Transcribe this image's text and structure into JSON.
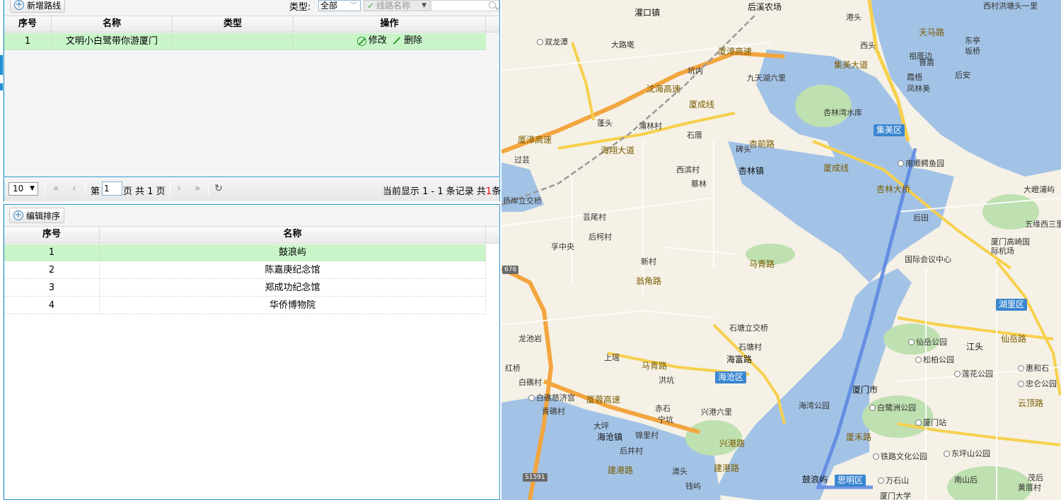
{
  "routes": {
    "add_button": "新增路线",
    "type_label": "类型:",
    "type_value": "全部",
    "search_placeholder": "线路名称",
    "columns": [
      "序号",
      "名称",
      "类型",
      "操作"
    ],
    "rows": [
      {
        "index": "1",
        "name": "文明小白鹭带你游厦门",
        "type": "",
        "edit": "修改",
        "delete": "删除"
      }
    ]
  },
  "pager": {
    "page_size": "10",
    "page_prefix": "第",
    "page_value": "1",
    "page_suffix": "页 共 1 页",
    "display_text": "当前显示  1 - 1 条记录  共",
    "total": "1",
    "total_suffix": "条"
  },
  "sites": {
    "edit_button": "编辑排序",
    "columns": [
      "序号",
      "名称"
    ],
    "rows": [
      {
        "index": "1",
        "name": "鼓浪屿"
      },
      {
        "index": "2",
        "name": "陈嘉庚纪念馆"
      },
      {
        "index": "3",
        "name": "郑成功纪念馆"
      },
      {
        "index": "4",
        "name": "华侨博物院"
      }
    ]
  },
  "map": {
    "labels": [
      "灌口镇",
      "后溪农场",
      "港头",
      "西村洪塘头一里",
      "双龙潭",
      "大路墘",
      "厦漳高速",
      "天马路",
      "西头",
      "祖厝边",
      "东亭",
      "坂桥",
      "坑内",
      "九天湖六里",
      "集美大道",
      "普盾",
      "霞梧",
      "后安",
      "凤林美",
      "沈海高速",
      "厦成线",
      "杏林湾水库",
      "集美区",
      "蓬头",
      "浦林村",
      "石厝",
      "杏前路",
      "厦漳高速",
      "碑头",
      "海翔大道",
      "南顺鳄鱼园",
      "过芸",
      "西滨村",
      "杏林镇",
      "厦成线",
      "杏林大桥",
      "大嶝浦屿",
      "蔡林",
      "扬岸立交桥",
      "后田",
      "五缘西三里",
      "芸尾村",
      "后柯村",
      "厦门高崎国际机场",
      "孚中央",
      "国际会议中心",
      "新村",
      "马青路",
      "翁角路",
      "湖里区",
      "676",
      "龙池岩",
      "石塘立交桥",
      "仙岳公园",
      "江头",
      "仙岳路",
      "上瑶",
      "石塘村",
      "松柏公园",
      "海富路",
      "马青路",
      "红桥",
      "海沧区",
      "莲花公园",
      "惠和石",
      "白礁村",
      "洪坑",
      "厦门市",
      "忠仑公园",
      "白礁慈济宫",
      "厦蓉高速",
      "海湾公园",
      "白鹭洲公园",
      "云顶路",
      "青礁村",
      "赤石",
      "兴港六里",
      "宁坑",
      "大坪",
      "锦里村",
      "厦门站",
      "海沧镇",
      "后井村",
      "厦禾路",
      "铁路文化公园",
      "东坪山公园",
      "澳头",
      "兴港路",
      "建港路",
      "S1591",
      "鼓浪屿",
      "思明区",
      "万石山",
      "南山后",
      "茂后",
      "黄厝村",
      "钱屿",
      "建港路",
      "厦门大学"
    ]
  }
}
